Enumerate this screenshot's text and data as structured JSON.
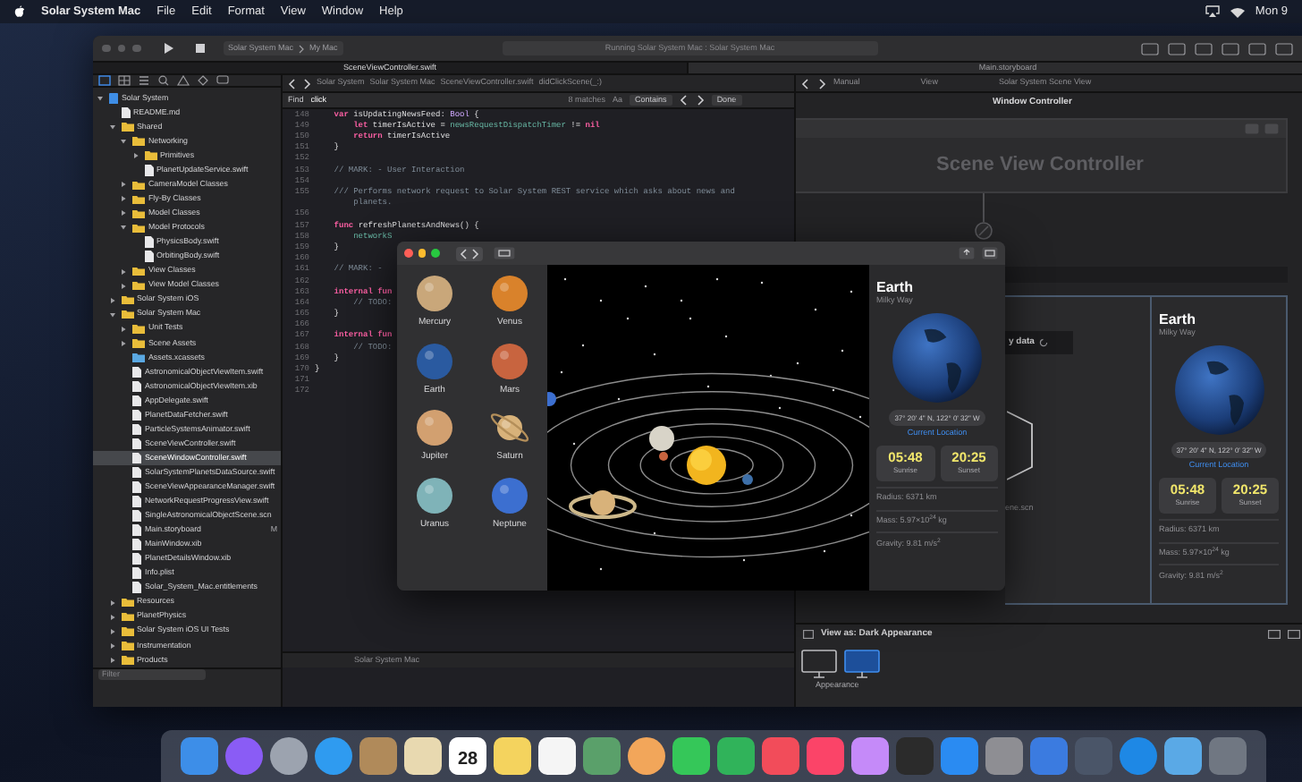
{
  "menu_bar": {
    "app_name": "Solar System Mac",
    "menus": [
      "File",
      "Edit",
      "Format",
      "View",
      "Window",
      "Help"
    ],
    "clock": "Mon 9"
  },
  "xcode": {
    "toolbar": {
      "scheme": "Solar System Mac",
      "destination": "My Mac",
      "activity": "Running Solar System Mac : Solar System Mac"
    },
    "tabs": [
      {
        "label": "SceneViewController.swift",
        "selected": true
      },
      {
        "label": "Main.storyboard",
        "selected": false
      }
    ],
    "navigator": {
      "items": [
        {
          "label": "Solar System",
          "kind": "project",
          "expanded": true,
          "selected": false,
          "children": [
            {
              "label": "README.md",
              "kind": "file",
              "selected": false
            },
            {
              "label": "Shared",
              "kind": "folder",
              "expanded": true,
              "selected": false,
              "children": [
                {
                  "label": "Networking",
                  "kind": "folder",
                  "expanded": true,
                  "selected": false,
                  "children": [
                    {
                      "label": "Primitives",
                      "kind": "folder",
                      "expanded": false,
                      "selected": false
                    },
                    {
                      "label": "PlanetUpdateService.swift",
                      "kind": "file",
                      "selected": false
                    }
                  ]
                },
                {
                  "label": "CameraModel Classes",
                  "kind": "folder",
                  "expanded": false,
                  "selected": false
                },
                {
                  "label": "Fly-By Classes",
                  "kind": "folder",
                  "expanded": false,
                  "selected": false
                },
                {
                  "label": "Model Classes",
                  "kind": "folder",
                  "expanded": false,
                  "selected": false
                },
                {
                  "label": "Model Protocols",
                  "kind": "folder",
                  "expanded": true,
                  "selected": false,
                  "children": [
                    {
                      "label": "PhysicsBody.swift",
                      "kind": "file",
                      "selected": false
                    },
                    {
                      "label": "OrbitingBody.swift",
                      "kind": "file",
                      "selected": false
                    }
                  ]
                },
                {
                  "label": "View Classes",
                  "kind": "folder",
                  "expanded": false,
                  "selected": false
                },
                {
                  "label": "View Model Classes",
                  "kind": "folder",
                  "expanded": false,
                  "selected": false
                }
              ]
            },
            {
              "label": "Solar System iOS",
              "kind": "folder",
              "expanded": false,
              "selected": false
            },
            {
              "label": "Solar System Mac",
              "kind": "folder",
              "expanded": true,
              "selected": false,
              "children": [
                {
                  "label": "Unit Tests",
                  "kind": "folder",
                  "expanded": false,
                  "selected": false
                },
                {
                  "label": "Scene Assets",
                  "kind": "folder",
                  "expanded": false,
                  "selected": false
                },
                {
                  "label": "Assets.xcassets",
                  "kind": "assets",
                  "selected": false
                },
                {
                  "label": "AstronomicalObjectViewItem.swift",
                  "kind": "file",
                  "selected": false
                },
                {
                  "label": "AstronomicalObjectViewItem.xib",
                  "kind": "file",
                  "selected": false
                },
                {
                  "label": "AppDelegate.swift",
                  "kind": "file",
                  "selected": false
                },
                {
                  "label": "PlanetDataFetcher.swift",
                  "kind": "file",
                  "selected": false
                },
                {
                  "label": "ParticleSystemsAnimator.swift",
                  "kind": "file",
                  "selected": false
                },
                {
                  "label": "SceneViewController.swift",
                  "kind": "file",
                  "selected": false
                },
                {
                  "label": "SceneWindowController.swift",
                  "kind": "file",
                  "selected": true
                },
                {
                  "label": "SolarSystemPlanetsDataSource.swift",
                  "kind": "file",
                  "selected": false
                },
                {
                  "label": "SceneViewAppearanceManager.swift",
                  "kind": "file",
                  "selected": false
                },
                {
                  "label": "NetworkRequestProgressView.swift",
                  "kind": "file",
                  "selected": false
                },
                {
                  "label": "SingleAstronomicalObjectScene.scn",
                  "kind": "file",
                  "selected": false
                },
                {
                  "label": "Main.storyboard",
                  "kind": "file",
                  "selected": false,
                  "badge": "M"
                },
                {
                  "label": "MainWindow.xib",
                  "kind": "file",
                  "selected": false
                },
                {
                  "label": "PlanetDetailsWindow.xib",
                  "kind": "file",
                  "selected": false
                },
                {
                  "label": "Info.plist",
                  "kind": "file",
                  "selected": false
                },
                {
                  "label": "Solar_System_Mac.entitlements",
                  "kind": "file",
                  "selected": false
                }
              ]
            },
            {
              "label": "Resources",
              "kind": "folder",
              "expanded": false,
              "selected": false
            },
            {
              "label": "PlanetPhysics",
              "kind": "folder",
              "expanded": false,
              "selected": false
            },
            {
              "label": "Solar System iOS UI Tests",
              "kind": "folder",
              "expanded": false,
              "selected": false
            },
            {
              "label": "Instrumentation",
              "kind": "folder",
              "expanded": false,
              "selected": false
            },
            {
              "label": "Products",
              "kind": "folder",
              "expanded": false,
              "selected": false
            }
          ]
        }
      ],
      "filter": {
        "placeholder": "Filter"
      }
    },
    "editor": {
      "jump_bar": [
        "Solar System",
        "Solar System Mac",
        "SceneViewController.swift",
        "didClickScene(_:)"
      ],
      "find": {
        "label": "Find",
        "value": "click",
        "matches": "8 matches",
        "case_button": "Aa",
        "mode": "Contains",
        "done": "Done"
      },
      "lines": [
        {
          "number": "148",
          "segments": [
            {
              "kind": "kw",
              "text": "    var "
            },
            {
              "kind": "plain",
              "text": "isUpdatingNewsFeed: "
            },
            {
              "kind": "type",
              "text": "Bool"
            },
            {
              "kind": "plain",
              "text": " {"
            }
          ]
        },
        {
          "number": "149",
          "segments": [
            {
              "kind": "kw",
              "text": "        let "
            },
            {
              "kind": "plain",
              "text": "timerIsActive = "
            },
            {
              "kind": "ident",
              "text": "newsRequestDispatchTimer"
            },
            {
              "kind": "plain",
              "text": " != "
            },
            {
              "kind": "kw",
              "text": "nil"
            }
          ]
        },
        {
          "number": "150",
          "segments": [
            {
              "kind": "kw",
              "text": "        return "
            },
            {
              "kind": "plain",
              "text": "timerIsActive"
            }
          ]
        },
        {
          "number": "151",
          "segments": [
            {
              "kind": "plain",
              "text": "    }"
            }
          ]
        },
        {
          "number": "152"
        },
        {
          "number": "153",
          "segments": [
            {
              "kind": "comment",
              "text": "    // MARK: - User Interaction"
            }
          ]
        },
        {
          "number": "154"
        },
        {
          "number": "155",
          "segments": [
            {
              "kind": "comment",
              "text": "    /// Performs network request to Solar System REST service which asks about news and"
            }
          ]
        },
        {
          "segments": [
            {
              "kind": "comment",
              "text": "        planets."
            }
          ]
        },
        {
          "number": "156"
        },
        {
          "number": "157",
          "segments": [
            {
              "kind": "kw",
              "text": "    func "
            },
            {
              "kind": "plain",
              "text": "refreshPlanetsAndNews() {"
            }
          ]
        },
        {
          "number": "158",
          "segments": [
            {
              "kind": "ident",
              "text": "        networkS"
            }
          ]
        },
        {
          "number": "159",
          "segments": [
            {
              "kind": "plain",
              "text": "    }"
            }
          ]
        },
        {
          "number": "160"
        },
        {
          "number": "161",
          "segments": [
            {
              "kind": "comment",
              "text": "    // MARK: - "
            }
          ]
        },
        {
          "number": "162"
        },
        {
          "number": "163",
          "segments": [
            {
              "kind": "kw",
              "text": "    internal fun"
            }
          ]
        },
        {
          "number": "164",
          "segments": [
            {
              "kind": "comment",
              "text": "        // TODO:"
            }
          ]
        },
        {
          "number": "165",
          "segments": [
            {
              "kind": "plain",
              "text": "    }"
            }
          ]
        },
        {
          "number": "166"
        },
        {
          "number": "167",
          "segments": [
            {
              "kind": "kw",
              "text": "    internal fun"
            }
          ]
        },
        {
          "number": "168",
          "segments": [
            {
              "kind": "comment",
              "text": "        // TODO:"
            }
          ]
        },
        {
          "number": "169",
          "segments": [
            {
              "kind": "plain",
              "text": "    }"
            }
          ]
        },
        {
          "number": "170",
          "segments": [
            {
              "kind": "plain",
              "text": "}"
            }
          ]
        },
        {
          "number": "171"
        },
        {
          "number": "172"
        }
      ],
      "status": "Solar System Mac"
    },
    "storyboard": {
      "jump_bar": [
        "Manual",
        "View",
        "Solar System Scene View"
      ],
      "window_controller_title": "Window Controller",
      "scene_title": "Scene View Controller",
      "loading_text": "y data",
      "scene_file": "ene.scn",
      "info": {
        "title": "Earth",
        "subtitle": "Milky Way",
        "coordinates": "37° 20' 4\" N, 122° 0' 32\" W",
        "location_link": "Current Location",
        "times": [
          {
            "time": "05:48",
            "label": "Sunrise"
          },
          {
            "time": "20:25",
            "label": "Sunset"
          }
        ],
        "facts": [
          "Radius: 6371 km",
          "Mass: 5.97×10$^{24}$ kg",
          "Gravity: 9.81 m/s$^{2}$"
        ]
      },
      "view_as": "View as: Dark Appearance",
      "appearance": {
        "label": "Appearance",
        "options": [
          {
            "kind": "light",
            "selected": false
          },
          {
            "kind": "dark",
            "selected": true
          }
        ]
      }
    }
  },
  "app_window": {
    "planets": [
      {
        "name": "Mercury",
        "color": "#c9a77a",
        "kind": "plain"
      },
      {
        "name": "Venus",
        "color": "#d9822b",
        "kind": "plain"
      },
      {
        "name": "Earth",
        "color": "#2a5aa0",
        "kind": "plain"
      },
      {
        "name": "Mars",
        "color": "#c8643f",
        "kind": "plain"
      },
      {
        "name": "Jupiter",
        "color": "#d2a070",
        "kind": "plain"
      },
      {
        "name": "Saturn",
        "color": "#d8b27a",
        "kind": "ringed"
      },
      {
        "name": "Uranus",
        "color": "#7fb3b8",
        "kind": "plain"
      },
      {
        "name": "Neptune",
        "color": "#3c6fd0",
        "kind": "plain"
      }
    ],
    "info": {
      "title": "Earth",
      "subtitle": "Milky Way",
      "coordinates": "37° 20' 4\" N, 122° 0' 32\" W",
      "location_link": "Current Location",
      "times": [
        {
          "time": "05:48",
          "label": "Sunrise"
        },
        {
          "time": "20:25",
          "label": "Sunset"
        }
      ],
      "facts": [
        "Radius: 6371 km",
        "Mass: 5.97×10$^{24}$ kg",
        "Gravity: 9.81 m/s$^{2}$"
      ]
    }
  },
  "dock": {
    "icons": [
      {
        "kind": "square",
        "color": "#3d8ee8"
      },
      {
        "kind": "round",
        "color": "#8a5cf5"
      },
      {
        "kind": "round",
        "color": "#9ca3af"
      },
      {
        "kind": "round",
        "color": "#2f9bf0"
      },
      {
        "kind": "square",
        "color": "#b08a5a"
      },
      {
        "kind": "square",
        "color": "#e8d9b0"
      },
      {
        "kind": "calendar",
        "color": "#ffffff",
        "day": "28"
      },
      {
        "kind": "square",
        "color": "#f4d35e"
      },
      {
        "kind": "square",
        "color": "#f5f5f5"
      },
      {
        "kind": "square",
        "color": "#5aa06a"
      },
      {
        "kind": "round",
        "color": "#f2a65a"
      },
      {
        "kind": "square",
        "color": "#35c759"
      },
      {
        "kind": "square",
        "color": "#30b35a"
      },
      {
        "kind": "square",
        "color": "#f24c5a"
      },
      {
        "kind": "square",
        "color": "#fb4468"
      },
      {
        "kind": "square",
        "color": "#c58af9"
      },
      {
        "kind": "square",
        "color": "#2b2b2b"
      },
      {
        "kind": "square",
        "color": "#2a8bf2"
      },
      {
        "kind": "square",
        "color": "#8e8e93"
      },
      {
        "kind": "square",
        "color": "#3b7be0"
      },
      {
        "kind": "square",
        "color": "#4a5568"
      },
      {
        "kind": "round",
        "color": "#1e88e5"
      },
      {
        "kind": "square",
        "color": "#5aa9e6"
      },
      {
        "kind": "square",
        "color": "#707782"
      }
    ]
  }
}
